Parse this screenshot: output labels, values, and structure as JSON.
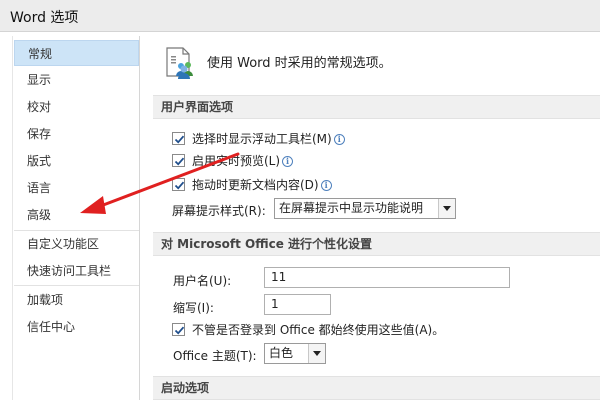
{
  "window": {
    "title": "Word 选项"
  },
  "sidebar": {
    "items": [
      {
        "label": "常规",
        "active": true
      },
      {
        "label": "显示"
      },
      {
        "label": "校对"
      },
      {
        "label": "保存"
      },
      {
        "label": "版式"
      },
      {
        "label": "语言"
      },
      {
        "label": "高级"
      },
      {
        "label": "自定义功能区"
      },
      {
        "label": "快速访问工具栏"
      },
      {
        "label": "加载项"
      },
      {
        "label": "信任中心"
      }
    ]
  },
  "main": {
    "header": "使用 Word 时采用的常规选项。",
    "sections": {
      "ui": {
        "title": "用户界面选项",
        "options": [
          {
            "label": "选择时显示浮动工具栏(M)",
            "checked": true
          },
          {
            "label": "启用实时预览(L)",
            "checked": true
          },
          {
            "label": "拖动时更新文档内容(D)",
            "checked": true
          }
        ],
        "screentip": {
          "label": "屏幕提示样式(R):",
          "value": "在屏幕提示中显示功能说明"
        }
      },
      "personalize": {
        "title": "对 Microsoft Office 进行个性化设置",
        "username": {
          "label": "用户名(U):",
          "value": "11"
        },
        "initials": {
          "label": "缩写(I):",
          "value": "1"
        },
        "always_use": {
          "label": "不管是否登录到 Office 都始终使用这些值(A)。",
          "checked": true
        },
        "theme": {
          "label": "Office 主题(T):",
          "value": "白色"
        }
      },
      "startup": {
        "title": "启动选项"
      }
    }
  },
  "annotation": {
    "arrow_color": "#e02020"
  },
  "colors": {
    "accent": "#cde4f7",
    "check": "#1f4e8c"
  }
}
